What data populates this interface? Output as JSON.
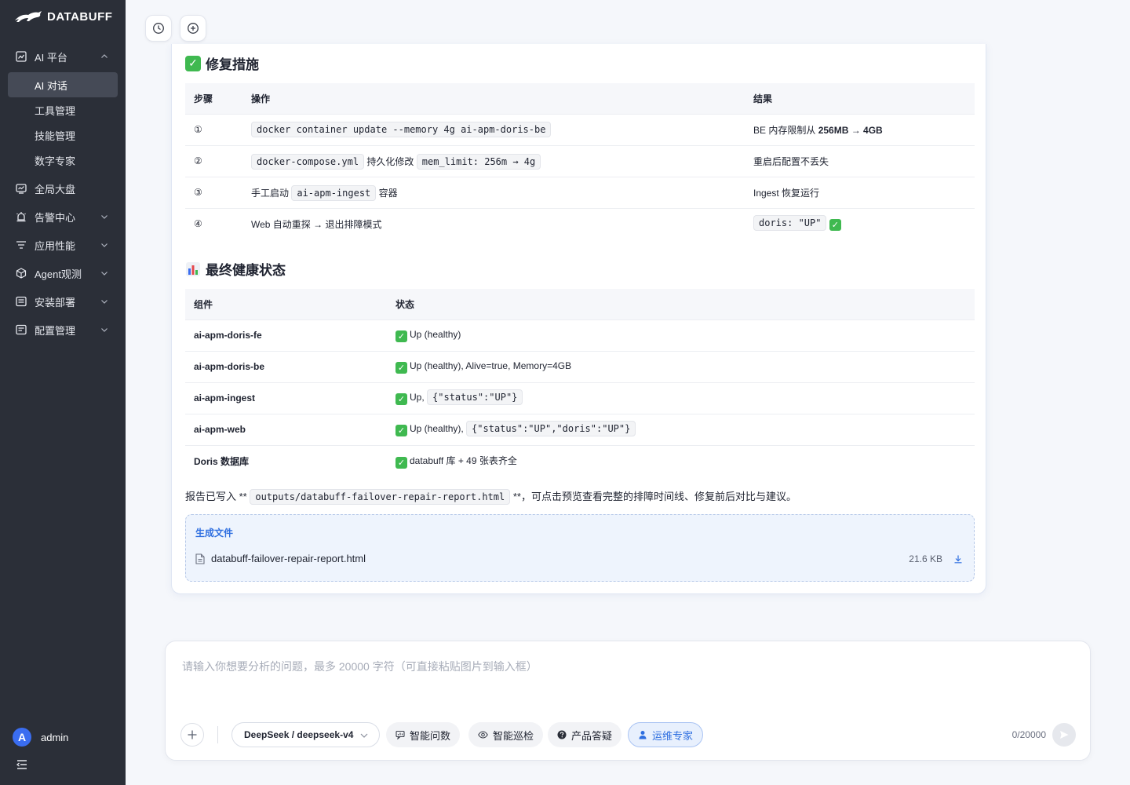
{
  "brand": {
    "name": "DATABUFF"
  },
  "sidebar": {
    "items": [
      {
        "label": "AI 平台",
        "icon": "ai-platform-icon",
        "expanded": true
      },
      {
        "label": "全局大盘",
        "icon": "dashboard-icon"
      },
      {
        "label": "告警中心",
        "icon": "alarm-icon"
      },
      {
        "label": "应用性能",
        "icon": "performance-icon"
      },
      {
        "label": "Agent观测",
        "icon": "agent-cube-icon"
      },
      {
        "label": "安装部署",
        "icon": "deploy-icon"
      },
      {
        "label": "配置管理",
        "icon": "config-icon"
      }
    ],
    "sub_items": [
      {
        "label": "AI 对话",
        "active": true
      },
      {
        "label": "工具管理"
      },
      {
        "label": "技能管理"
      },
      {
        "label": "数字专家"
      }
    ],
    "user": {
      "initial": "A",
      "name": "admin"
    }
  },
  "top_actions": {
    "history": "history-icon",
    "new_chat": "new-chat-icon"
  },
  "repair": {
    "title": "修复措施",
    "headers": [
      "步骤",
      "操作",
      "结果"
    ],
    "rows": [
      {
        "step": "①",
        "op_code": "docker container update --memory 4g ai-apm-doris-be",
        "result_pre": "BE 内存限制从 ",
        "result_bold": "256MB → 4GB"
      },
      {
        "step": "②",
        "op_code1": "docker-compose.yml",
        "op_text": "持久化修改",
        "op_code2": "mem_limit: 256m → 4g",
        "result": "重启后配置不丢失"
      },
      {
        "step": "③",
        "op_pre": "手工启动",
        "op_code": "ai-apm-ingest",
        "op_post": "容器",
        "result": "Ingest 恢复运行"
      },
      {
        "step": "④",
        "op": "Web 自动重探 → 退出排障模式",
        "result_code": "doris: \"UP\""
      }
    ]
  },
  "health": {
    "title": "最终健康状态",
    "headers": [
      "组件",
      "状态"
    ],
    "rows": [
      {
        "component": "ai-apm-doris-fe",
        "status": "Up (healthy)"
      },
      {
        "component": "ai-apm-doris-be",
        "status": "Up (healthy), Alive=true, Memory=4GB"
      },
      {
        "component": "ai-apm-ingest",
        "status": "Up,",
        "status_code": "{\"status\":\"UP\"}"
      },
      {
        "component": "ai-apm-web",
        "status": "Up (healthy),",
        "status_code": "{\"status\":\"UP\",\"doris\":\"UP\"}"
      },
      {
        "component": "Doris 数据库",
        "status": "databuff 库 + 49 张表齐全"
      }
    ]
  },
  "report": {
    "pre": "报告已写入 ** ",
    "path": "outputs/databuff-failover-repair-report.html",
    "post": " **，可点击预览查看完整的排障时间线、修复前后对比与建议。"
  },
  "files": {
    "title": "生成文件",
    "items": [
      {
        "name": "databuff-failover-repair-report.html",
        "size": "21.6 KB"
      }
    ]
  },
  "composer": {
    "placeholder": "请输入你想要分析的问题，最多 20000 字符（可直接粘贴图片到输入框）",
    "model": "DeepSeek / deepseek-v4",
    "modes": [
      {
        "label": "智能问数",
        "icon": "chat-data-icon"
      },
      {
        "label": "智能巡检",
        "icon": "eye-icon"
      },
      {
        "label": "产品答疑",
        "icon": "help-icon"
      },
      {
        "label": "运维专家",
        "icon": "user-icon",
        "active": true
      }
    ],
    "counter": "0/20000"
  },
  "colors": {
    "sidebar_bg": "#2b2f38",
    "accent": "#2f6fe0",
    "success": "#3fb950"
  }
}
